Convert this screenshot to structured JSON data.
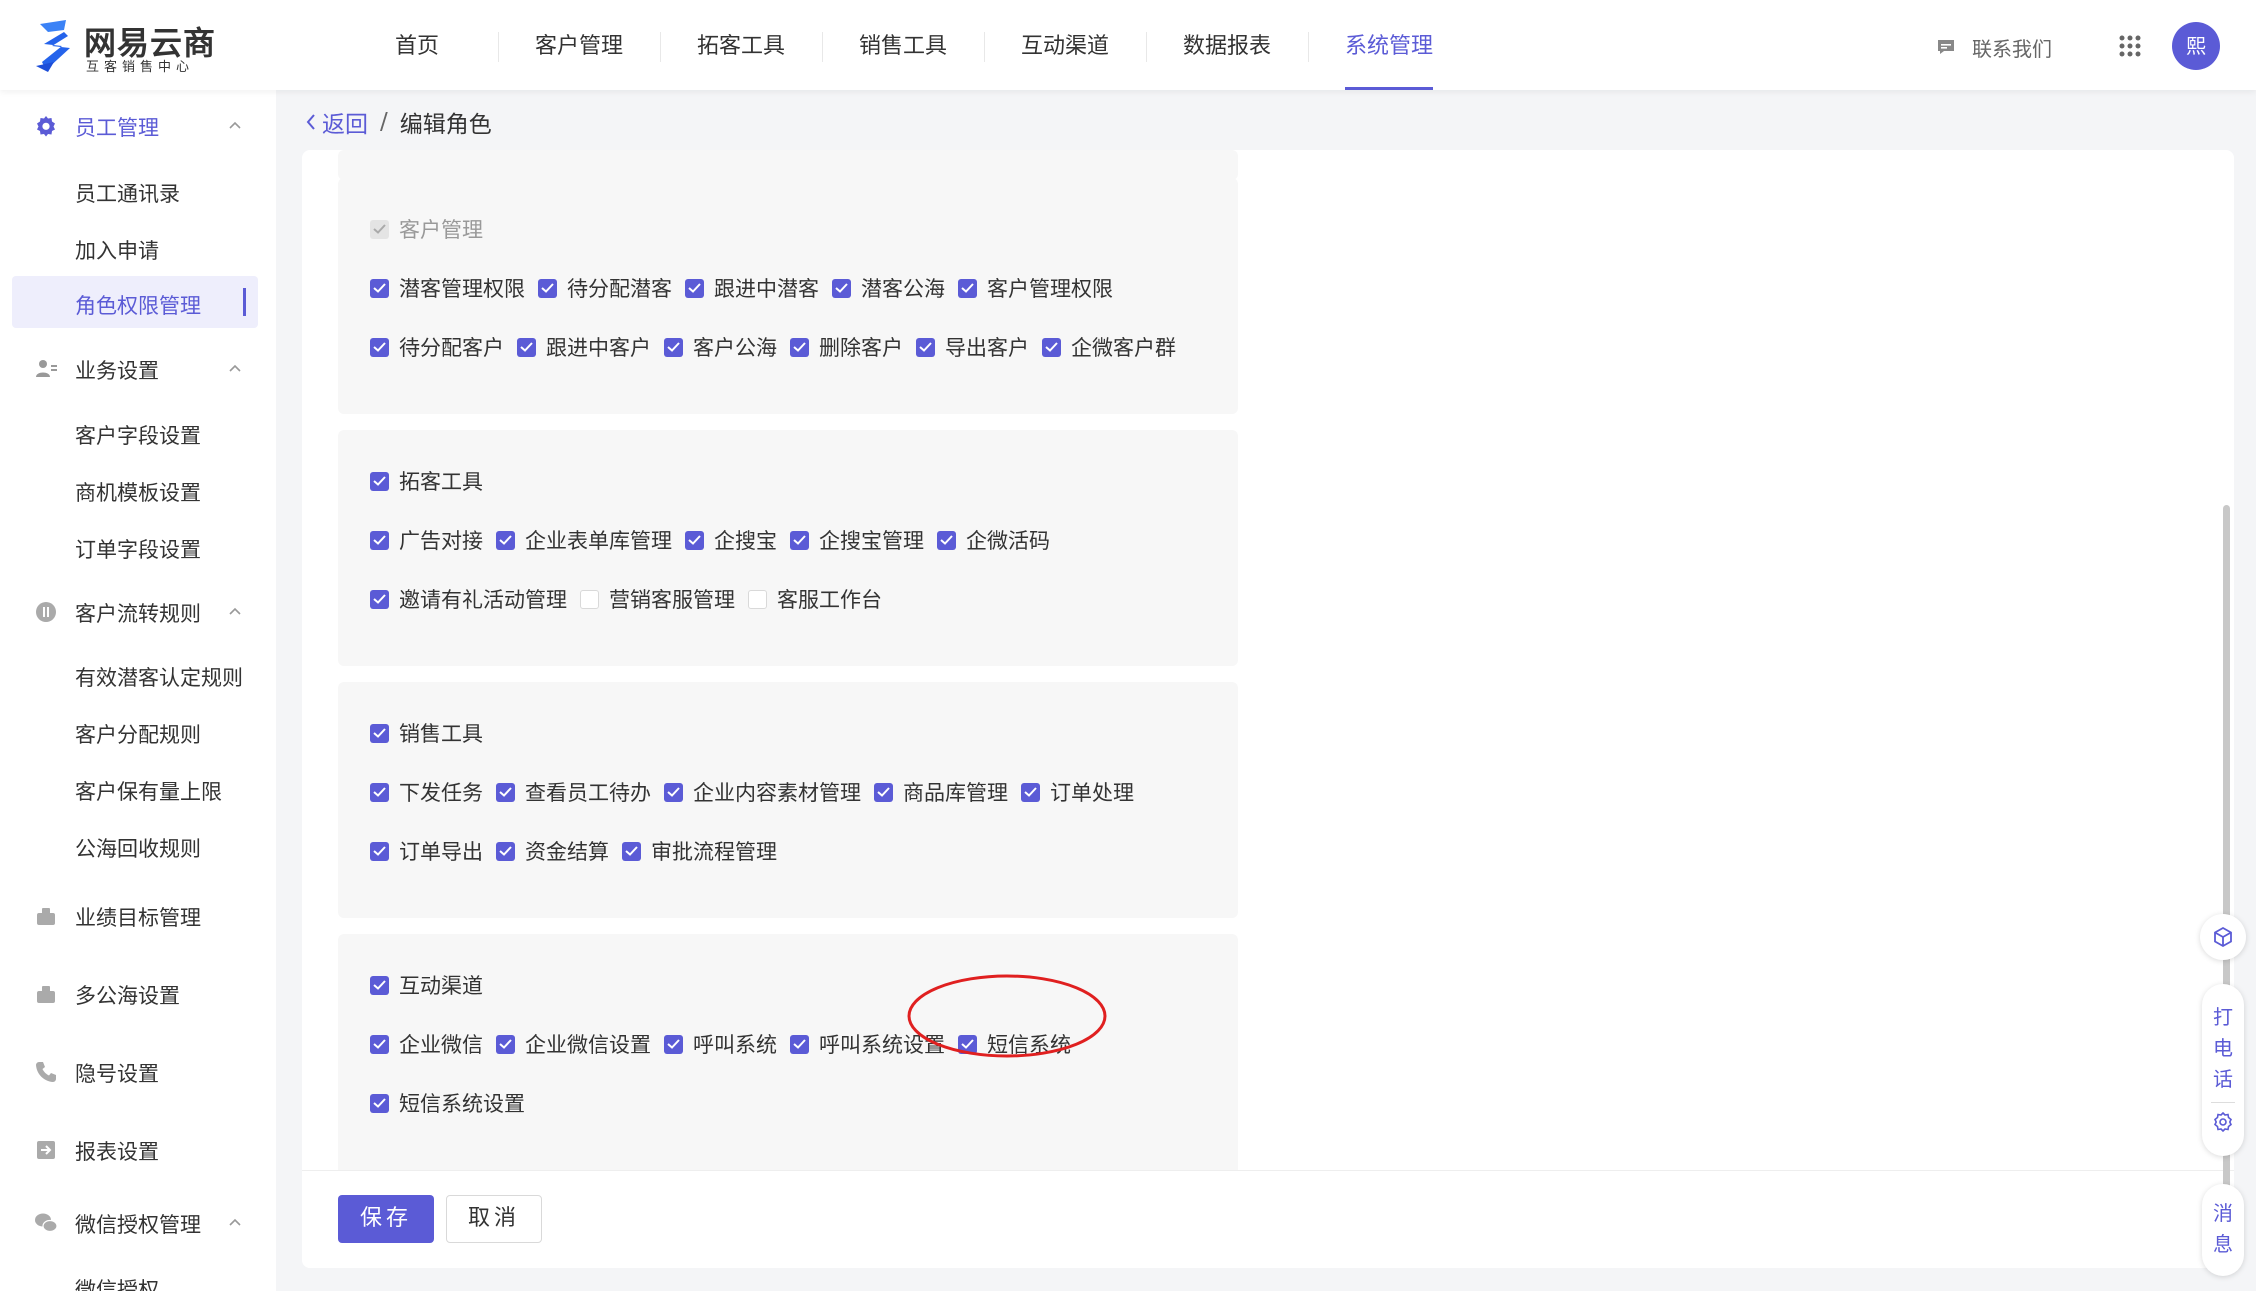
{
  "brand": {
    "title": "网易云商",
    "subtitle": "互客销售中心"
  },
  "nav": [
    {
      "label": "首页",
      "active": false
    },
    {
      "label": "客户管理",
      "active": false
    },
    {
      "label": "拓客工具",
      "active": false
    },
    {
      "label": "销售工具",
      "active": false
    },
    {
      "label": "互动渠道",
      "active": false
    },
    {
      "label": "数据报表",
      "active": false
    },
    {
      "label": "系统管理",
      "active": true
    }
  ],
  "header": {
    "contact_label": "联系我们",
    "avatar_text": "熙"
  },
  "sidebar": {
    "groups": [
      {
        "label": "员工管理",
        "icon": "gear-icon",
        "active": true,
        "expanded": true,
        "items": [
          {
            "label": "员工通讯录"
          },
          {
            "label": "加入申请"
          },
          {
            "label": "角色权限管理",
            "active": true
          }
        ]
      },
      {
        "label": "业务设置",
        "icon": "user-settings-icon",
        "expanded": true,
        "items": [
          {
            "label": "客户字段设置"
          },
          {
            "label": "商机模板设置"
          },
          {
            "label": "订单字段设置"
          }
        ]
      },
      {
        "label": "客户流转规则",
        "icon": "flow-icon",
        "expanded": true,
        "items": [
          {
            "label": "有效潜客认定规则"
          },
          {
            "label": "客户分配规则"
          },
          {
            "label": "客户保有量上限"
          },
          {
            "label": "公海回收规则"
          }
        ]
      },
      {
        "label": "业绩目标管理",
        "icon": "target-icon"
      },
      {
        "label": "多公海设置",
        "icon": "pool-icon"
      },
      {
        "label": "隐号设置",
        "icon": "phone-icon"
      },
      {
        "label": "报表设置",
        "icon": "report-icon"
      },
      {
        "label": "微信授权管理",
        "icon": "wechat-icon",
        "expanded": true,
        "items": [
          {
            "label": "微信授权"
          }
        ]
      }
    ]
  },
  "breadcrumb": {
    "back": "返回",
    "separator": "/",
    "current": "编辑角色"
  },
  "sections": [
    {
      "title": "客户管理",
      "checked": true,
      "disabled": true,
      "rows": [
        [
          {
            "label": "潜客管理权限",
            "checked": true
          },
          {
            "label": "待分配潜客",
            "checked": true
          },
          {
            "label": "跟进中潜客",
            "checked": true
          },
          {
            "label": "潜客公海",
            "checked": true
          },
          {
            "label": "客户管理权限",
            "checked": true
          }
        ],
        [
          {
            "label": "待分配客户",
            "checked": true
          },
          {
            "label": "跟进中客户",
            "checked": true
          },
          {
            "label": "客户公海",
            "checked": true
          },
          {
            "label": "删除客户",
            "checked": true
          },
          {
            "label": "导出客户",
            "checked": true
          },
          {
            "label": "企微客户群",
            "checked": true
          }
        ]
      ]
    },
    {
      "title": "拓客工具",
      "checked": true,
      "rows": [
        [
          {
            "label": "广告对接",
            "checked": true
          },
          {
            "label": "企业表单库管理",
            "checked": true
          },
          {
            "label": "企搜宝",
            "checked": true
          },
          {
            "label": "企搜宝管理",
            "checked": true
          },
          {
            "label": "企微活码",
            "checked": true
          }
        ],
        [
          {
            "label": "邀请有礼活动管理",
            "checked": true
          },
          {
            "label": "营销客服管理",
            "checked": false
          },
          {
            "label": "客服工作台",
            "checked": false
          }
        ]
      ]
    },
    {
      "title": "销售工具",
      "checked": true,
      "rows": [
        [
          {
            "label": "下发任务",
            "checked": true
          },
          {
            "label": "查看员工待办",
            "checked": true
          },
          {
            "label": "企业内容素材管理",
            "checked": true
          },
          {
            "label": "商品库管理",
            "checked": true
          },
          {
            "label": "订单处理",
            "checked": true
          }
        ],
        [
          {
            "label": "订单导出",
            "checked": true
          },
          {
            "label": "资金结算",
            "checked": true
          },
          {
            "label": "审批流程管理",
            "checked": true
          }
        ]
      ]
    },
    {
      "title": "互动渠道",
      "checked": true,
      "rows": [
        [
          {
            "label": "企业微信",
            "checked": true
          },
          {
            "label": "企业微信设置",
            "checked": true
          },
          {
            "label": "呼叫系统",
            "checked": true
          },
          {
            "label": "呼叫系统设置",
            "checked": true
          },
          {
            "label": "短信系统",
            "checked": true
          }
        ],
        [
          {
            "label": "短信系统设置",
            "checked": true
          }
        ]
      ]
    }
  ],
  "footer": {
    "save": "保存",
    "cancel": "取消"
  },
  "floating": {
    "phone": [
      "打",
      "电",
      "话"
    ],
    "message": [
      "消",
      "息"
    ]
  },
  "colors": {
    "accent": "#5b5bd6",
    "annotation": "#e02020"
  }
}
